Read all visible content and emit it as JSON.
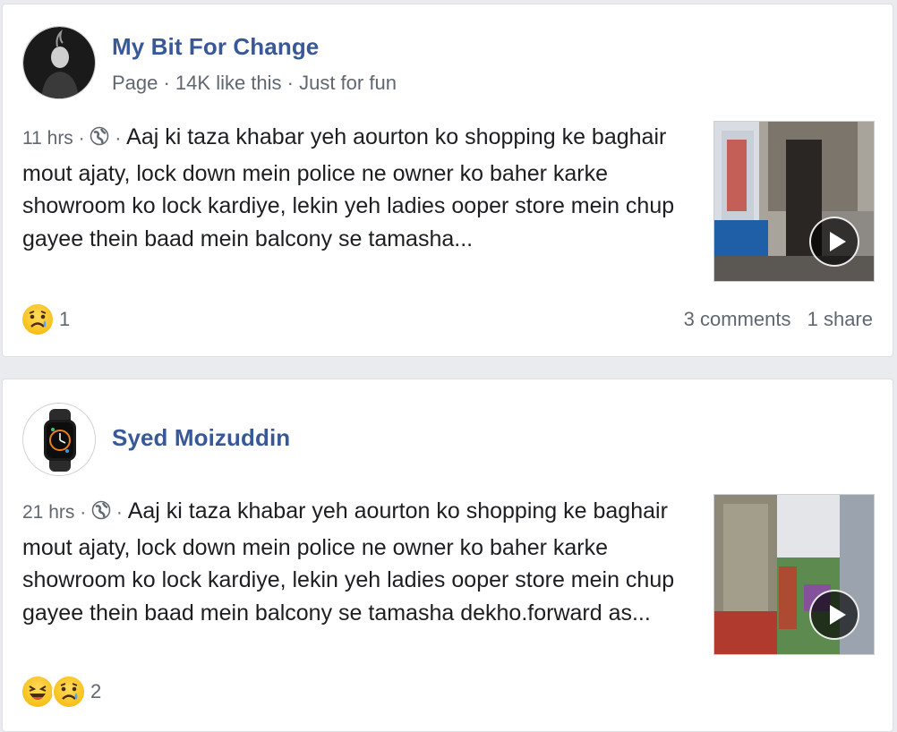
{
  "posts": [
    {
      "author": "My Bit For Change",
      "meta": "Page · 14K like this · Just for fun",
      "time": "11 hrs",
      "text": "Aaj ki taza khabar yeh aourton ko shopping ke baghair mout ajaty, lock down mein police ne owner ko baher karke showroom ko lock kardiye, lekin yeh ladies ooper store mein chup gayee thein baad mein balcony se tamasha...",
      "reaction_count": "1",
      "comments": "3 comments",
      "shares": "1 share",
      "reactions": [
        "sad-emoji"
      ]
    },
    {
      "author": "Syed Moizuddin",
      "time": "21 hrs",
      "text": "Aaj ki taza khabar yeh aourton ko shopping ke baghair mout ajaty, lock down mein police ne owner ko baher karke showroom ko lock kardiye, lekin yeh ladies ooper store mein chup gayee thein baad mein balcony se tamasha dekho.forward as...",
      "reaction_count": "2",
      "reactions": [
        "laugh-emoji",
        "sad-emoji"
      ]
    }
  ],
  "icons": {
    "globe": "globe-icon",
    "play": "play-icon"
  },
  "colors": {
    "link": "#385898",
    "muted": "#606770",
    "background": "#e9ebee"
  }
}
